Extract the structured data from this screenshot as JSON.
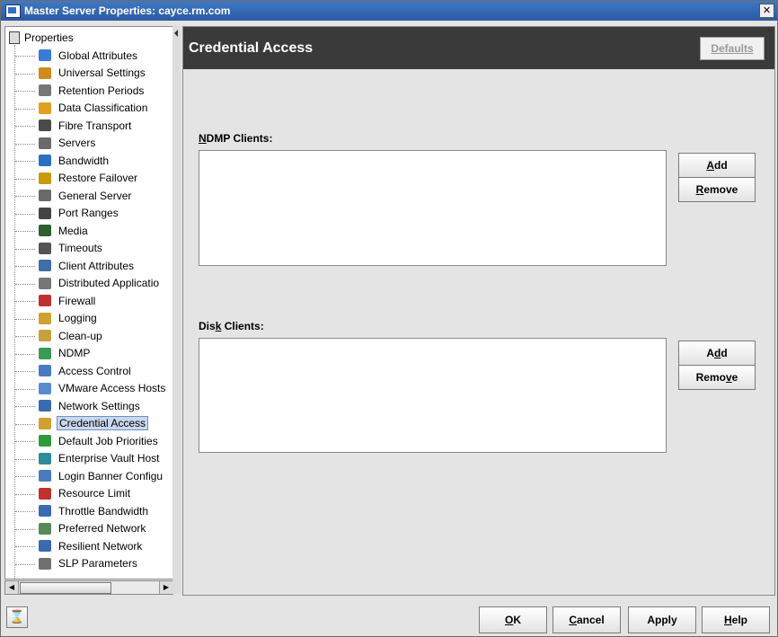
{
  "window": {
    "title": "Master Server Properties: cayce.rm.com",
    "close_label": "✕"
  },
  "tree": {
    "root_label": "Properties",
    "items": [
      {
        "label": "Global Attributes",
        "icon": "globe-icon",
        "color": "#3a7bd5"
      },
      {
        "label": "Universal Settings",
        "icon": "universal-settings-icon",
        "color": "#d08a1e"
      },
      {
        "label": "Retention Periods",
        "icon": "retention-icon",
        "color": "#777777"
      },
      {
        "label": "Data Classification",
        "icon": "data-classification-icon",
        "color": "#e0a020"
      },
      {
        "label": "Fibre Transport",
        "icon": "fibre-transport-icon",
        "color": "#4a4a4a"
      },
      {
        "label": "Servers",
        "icon": "server-icon",
        "color": "#6a6a6a"
      },
      {
        "label": "Bandwidth",
        "icon": "bandwidth-icon",
        "color": "#2a6fc0"
      },
      {
        "label": "Restore Failover",
        "icon": "restore-failover-icon",
        "color": "#c89a10"
      },
      {
        "label": "General Server",
        "icon": "general-server-icon",
        "color": "#6a6a6a"
      },
      {
        "label": "Port Ranges",
        "icon": "port-ranges-icon",
        "color": "#444444"
      },
      {
        "label": "Media",
        "icon": "media-icon",
        "color": "#2f5f2f"
      },
      {
        "label": "Timeouts",
        "icon": "timeout-icon",
        "color": "#555555"
      },
      {
        "label": "Client Attributes",
        "icon": "client-attributes-icon",
        "color": "#3f6fa8"
      },
      {
        "label": "Distributed Applicatio",
        "icon": "distributed-application-icon",
        "color": "#777777"
      },
      {
        "label": "Firewall",
        "icon": "firewall-icon",
        "color": "#c03030"
      },
      {
        "label": "Logging",
        "icon": "logging-icon",
        "color": "#d0a030"
      },
      {
        "label": "Clean-up",
        "icon": "clean-up-icon",
        "color": "#c8a040"
      },
      {
        "label": "NDMP",
        "icon": "ndmp-icon",
        "color": "#3a9a5a"
      },
      {
        "label": "Access Control",
        "icon": "access-control-icon",
        "color": "#4a7ac0"
      },
      {
        "label": "VMware Access Hosts",
        "icon": "vmware-access-icon",
        "color": "#5a8ad0"
      },
      {
        "label": "Network Settings",
        "icon": "network-settings-icon",
        "color": "#3a6ab0"
      },
      {
        "label": "Credential Access",
        "icon": "credential-access-icon",
        "color": "#d0a030",
        "selected": true
      },
      {
        "label": "Default Job Priorities",
        "icon": "job-priorities-icon",
        "color": "#2f9a3a"
      },
      {
        "label": "Enterprise Vault Host",
        "icon": "enterprise-vault-icon",
        "color": "#2f8a9a"
      },
      {
        "label": "Login Banner Configu",
        "icon": "login-banner-icon",
        "color": "#4a7ac0"
      },
      {
        "label": "Resource Limit",
        "icon": "resource-limit-icon",
        "color": "#c03030"
      },
      {
        "label": "Throttle Bandwidth",
        "icon": "throttle-bandwidth-icon",
        "color": "#3a6ab0"
      },
      {
        "label": "Preferred Network",
        "icon": "preferred-network-icon",
        "color": "#5a8a5a"
      },
      {
        "label": "Resilient Network",
        "icon": "resilient-network-icon",
        "color": "#3a6ab0"
      },
      {
        "label": "SLP Parameters",
        "icon": "slp-parameters-icon",
        "color": "#707070"
      }
    ]
  },
  "scrollbar": {
    "left_arrow": "◀",
    "right_arrow": "▶"
  },
  "content": {
    "title": "Credential Access",
    "defaults_label": "Defaults",
    "ndmp": {
      "label_u": "N",
      "label_rest": "DMP Clients:",
      "add_u": "A",
      "add_rest": "dd",
      "remove_u": "R",
      "remove_rest": "emove"
    },
    "disk": {
      "label_pre": "Dis",
      "label_u": "k",
      "label_rest": " Clients:",
      "add_pre": "A",
      "add_u": "d",
      "add_rest": "d",
      "remove_pre": "Remo",
      "remove_u": "v",
      "remove_rest": "e"
    }
  },
  "footer": {
    "hourglass": "⌛",
    "ok_u": "O",
    "ok_rest": "K",
    "cancel_u": "C",
    "cancel_rest": "ancel",
    "apply_label": "Apply",
    "help_u": "H",
    "help_rest": "elp"
  }
}
